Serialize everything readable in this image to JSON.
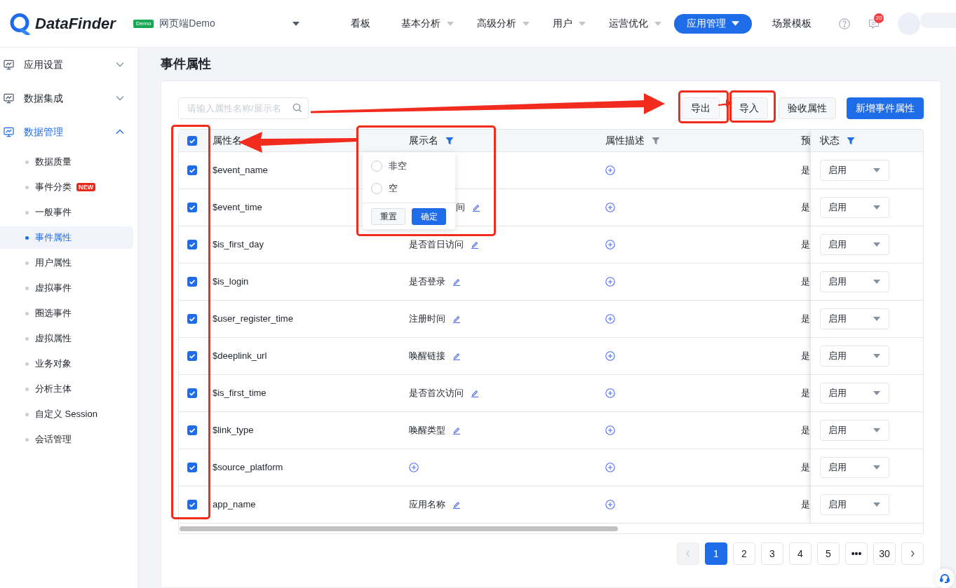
{
  "header": {
    "logo": "DataFinder",
    "project": {
      "badge": "Demo",
      "name": "网页端Demo"
    },
    "nav": [
      {
        "label": "看板",
        "has_menu": false,
        "selected": false
      },
      {
        "label": "基本分析",
        "has_menu": true,
        "selected": false
      },
      {
        "label": "高级分析",
        "has_menu": true,
        "selected": false
      },
      {
        "label": "用户",
        "has_menu": true,
        "selected": false
      },
      {
        "label": "运营优化",
        "has_menu": true,
        "selected": false
      },
      {
        "label": "应用管理",
        "has_menu": true,
        "selected": true
      },
      {
        "label": "场景模板",
        "has_menu": false,
        "selected": false
      }
    ],
    "notification_count": "20"
  },
  "sidebar": {
    "groups": [
      {
        "label": "应用设置",
        "expanded": false,
        "selected": false
      },
      {
        "label": "数据集成",
        "expanded": false,
        "selected": false
      },
      {
        "label": "数据管理",
        "expanded": true,
        "selected": true,
        "children": [
          {
            "label": "数据质量",
            "selected": false
          },
          {
            "label": "事件分类",
            "badge": "NEW",
            "selected": false
          },
          {
            "label": "一般事件",
            "selected": false
          },
          {
            "label": "事件属性",
            "selected": true
          },
          {
            "label": "用户属性",
            "selected": false
          },
          {
            "label": "虚拟事件",
            "selected": false
          },
          {
            "label": "圈选事件",
            "selected": false
          },
          {
            "label": "虚拟属性",
            "selected": false
          },
          {
            "label": "业务对象",
            "selected": false
          },
          {
            "label": "分析主体",
            "selected": false
          },
          {
            "label": "自定义 Session",
            "selected": false
          },
          {
            "label": "会话管理",
            "selected": false
          }
        ]
      }
    ]
  },
  "page": {
    "title": "事件属性"
  },
  "toolbar": {
    "search": {
      "placeholder": "请输入属性名称/展示名"
    },
    "buttons": [
      {
        "label": "导出",
        "kind": "default"
      },
      {
        "label": "导入",
        "kind": "default"
      },
      {
        "label": "验收属性",
        "kind": "default"
      },
      {
        "label": "新增事件属性",
        "kind": "primary"
      }
    ]
  },
  "table": {
    "select_all": {
      "checked": true
    },
    "columns": [
      {
        "label": "属性名"
      },
      {
        "label": "展示名",
        "filter": {
          "active": true
        }
      },
      {
        "label": "属性描述",
        "filter": {
          "active": false
        }
      },
      {
        "label": "预"
      },
      {
        "label": "状态",
        "filter": {
          "active": true
        }
      }
    ],
    "rows": [
      {
        "checked": true,
        "name": "$event_name",
        "description": {
          "kind": "add"
        },
        "preset": "是",
        "status": "启用"
      },
      {
        "checked": true,
        "name": "$event_time",
        "display": {
          "kind": "covered",
          "text": "间"
        },
        "description": {
          "kind": "add"
        },
        "preset": "是",
        "status": "启用"
      },
      {
        "checked": true,
        "name": "$is_first_day",
        "display": {
          "kind": "text",
          "text": "是否首日访问"
        },
        "description": {
          "kind": "add"
        },
        "preset": "是",
        "status": "启用"
      },
      {
        "checked": true,
        "name": "$is_login",
        "display": {
          "kind": "text",
          "text": "是否登录"
        },
        "description": {
          "kind": "add"
        },
        "preset": "是",
        "status": "启用"
      },
      {
        "checked": true,
        "name": "$user_register_time",
        "display": {
          "kind": "text",
          "text": "注册时间"
        },
        "description": {
          "kind": "add"
        },
        "preset": "是",
        "status": "启用"
      },
      {
        "checked": true,
        "name": "$deeplink_url",
        "display": {
          "kind": "text",
          "text": "唤醒链接"
        },
        "description": {
          "kind": "add"
        },
        "preset": "是",
        "status": "启用"
      },
      {
        "checked": true,
        "name": "$is_first_time",
        "display": {
          "kind": "text",
          "text": "是否首次访问"
        },
        "description": {
          "kind": "add"
        },
        "preset": "是",
        "status": "启用"
      },
      {
        "checked": true,
        "name": "$link_type",
        "display": {
          "kind": "text",
          "text": "唤醒类型"
        },
        "description": {
          "kind": "add"
        },
        "preset": "是",
        "status": "启用"
      },
      {
        "checked": true,
        "name": "$source_platform",
        "display": {
          "kind": "add"
        },
        "description": {
          "kind": "add"
        },
        "preset": "是",
        "status": "启用"
      },
      {
        "checked": true,
        "name": "app_name",
        "display": {
          "kind": "text",
          "text": "应用名称"
        },
        "description": {
          "kind": "add"
        },
        "preset": "是",
        "status": "启用"
      }
    ],
    "filter_popup": {
      "options": [
        {
          "label": "非空",
          "selected": false
        },
        {
          "label": "空",
          "selected": false
        }
      ],
      "buttons": [
        {
          "label": "重置",
          "kind": "default"
        },
        {
          "label": "确定",
          "kind": "primary"
        }
      ]
    }
  },
  "pagination": {
    "prev": {
      "disabled": true
    },
    "pages": [
      {
        "label": "1",
        "kind": "page",
        "selected": true
      },
      {
        "label": "2",
        "kind": "page",
        "selected": false
      },
      {
        "label": "3",
        "kind": "page",
        "selected": false
      },
      {
        "label": "4",
        "kind": "page",
        "selected": false
      },
      {
        "label": "5",
        "kind": "page",
        "selected": false
      },
      {
        "label": "•••",
        "kind": "ellipsis",
        "selected": false
      },
      {
        "label": "30",
        "kind": "page",
        "selected": false
      }
    ],
    "next": {
      "disabled": false
    }
  }
}
